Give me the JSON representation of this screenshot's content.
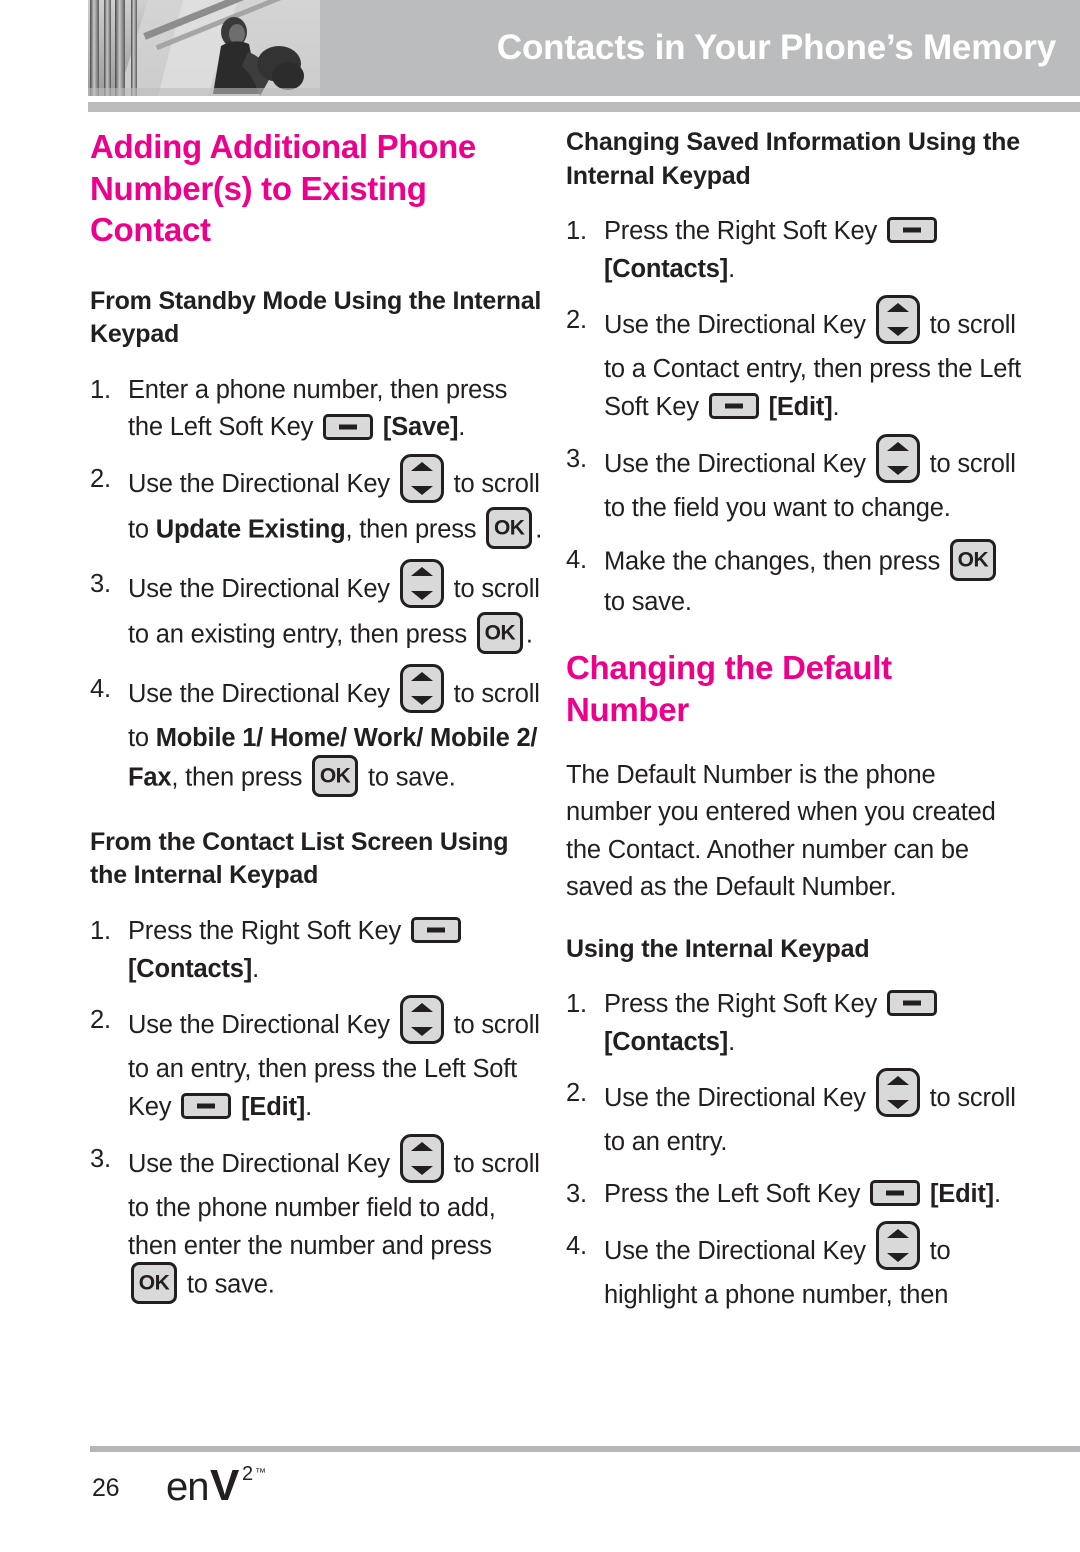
{
  "header": {
    "title": "Contacts in Your Phone’s Memory",
    "photo_alt": "person-by-railings-photo"
  },
  "colors": {
    "accent_pink": "#ec008c",
    "header_gray": "#bbbcbe",
    "text_black": "#231f20",
    "key_fill": "#d9d9da"
  },
  "left_column": {
    "section_title": "Adding Additional Phone Number(s) to Existing Contact",
    "sub1": {
      "heading": "From Standby Mode Using the Internal Keypad",
      "steps": [
        {
          "num": "1.",
          "parts": [
            {
              "t": "text",
              "v": "Enter a phone number, then press the Left Soft Key "
            },
            {
              "t": "icon",
              "v": "soft-key"
            },
            {
              "t": "text",
              "v": " "
            },
            {
              "t": "bold",
              "v": "[Save]"
            },
            {
              "t": "text",
              "v": "."
            }
          ]
        },
        {
          "num": "2.",
          "parts": [
            {
              "t": "text",
              "v": "Use the Directional Key "
            },
            {
              "t": "icon",
              "v": "directional-key"
            },
            {
              "t": "text",
              "v": " to scroll to "
            },
            {
              "t": "bold",
              "v": "Update Existing"
            },
            {
              "t": "text",
              "v": ", then press "
            },
            {
              "t": "icon",
              "v": "ok-key"
            },
            {
              "t": "text",
              "v": "."
            }
          ]
        },
        {
          "num": "3.",
          "parts": [
            {
              "t": "text",
              "v": "Use the Directional Key "
            },
            {
              "t": "icon",
              "v": "directional-key"
            },
            {
              "t": "text",
              "v": " to scroll to an existing entry, then press "
            },
            {
              "t": "icon",
              "v": "ok-key"
            },
            {
              "t": "text",
              "v": "."
            }
          ]
        },
        {
          "num": "4.",
          "parts": [
            {
              "t": "text",
              "v": "Use the Directional Key "
            },
            {
              "t": "icon",
              "v": "directional-key"
            },
            {
              "t": "text",
              "v": " to scroll to "
            },
            {
              "t": "bold",
              "v": "Mobile 1/ Home/ Work/ Mobile 2/ Fax"
            },
            {
              "t": "text",
              "v": ", then press "
            },
            {
              "t": "icon",
              "v": "ok-key"
            },
            {
              "t": "text",
              "v": " to save."
            }
          ]
        }
      ]
    },
    "sub2": {
      "heading": "From the Contact List Screen Using the Internal Keypad",
      "steps": [
        {
          "num": "1.",
          "parts": [
            {
              "t": "text",
              "v": "Press the Right Soft Key "
            },
            {
              "t": "icon",
              "v": "soft-key"
            },
            {
              "t": "text",
              "v": " "
            },
            {
              "t": "bold",
              "v": "[Contacts]"
            },
            {
              "t": "text",
              "v": "."
            }
          ]
        },
        {
          "num": "2.",
          "parts": [
            {
              "t": "text",
              "v": "Use the Directional Key "
            },
            {
              "t": "icon",
              "v": "directional-key"
            },
            {
              "t": "text",
              "v": " to scroll to an entry, then press the Left Soft Key "
            },
            {
              "t": "icon",
              "v": "soft-key"
            },
            {
              "t": "text",
              "v": " "
            },
            {
              "t": "bold",
              "v": "[Edit]"
            },
            {
              "t": "text",
              "v": "."
            }
          ]
        },
        {
          "num": "3.",
          "parts": [
            {
              "t": "text",
              "v": "Use the Directional Key "
            },
            {
              "t": "icon",
              "v": "directional-key"
            },
            {
              "t": "text",
              "v": " to scroll to the phone number field to add, then enter the number and press "
            },
            {
              "t": "icon",
              "v": "ok-key"
            },
            {
              "t": "text",
              "v": " to save."
            }
          ]
        }
      ]
    }
  },
  "right_column": {
    "sub1": {
      "heading": "Changing Saved Information Using the Internal Keypad",
      "steps": [
        {
          "num": "1.",
          "parts": [
            {
              "t": "text",
              "v": "Press the Right Soft Key "
            },
            {
              "t": "icon",
              "v": "soft-key"
            },
            {
              "t": "text",
              "v": " "
            },
            {
              "t": "bold",
              "v": "[Contacts]"
            },
            {
              "t": "text",
              "v": "."
            }
          ]
        },
        {
          "num": "2.",
          "parts": [
            {
              "t": "text",
              "v": "Use the Directional Key "
            },
            {
              "t": "icon",
              "v": "directional-key"
            },
            {
              "t": "text",
              "v": " to scroll to a Contact entry, then press the Left Soft Key "
            },
            {
              "t": "icon",
              "v": "soft-key"
            },
            {
              "t": "text",
              "v": " "
            },
            {
              "t": "bold",
              "v": "[Edit]"
            },
            {
              "t": "text",
              "v": "."
            }
          ]
        },
        {
          "num": "3.",
          "parts": [
            {
              "t": "text",
              "v": "Use the Directional Key "
            },
            {
              "t": "icon",
              "v": "directional-key"
            },
            {
              "t": "text",
              "v": " to scroll to the field you want to change."
            }
          ]
        },
        {
          "num": "4.",
          "parts": [
            {
              "t": "text",
              "v": "Make the changes, then press "
            },
            {
              "t": "icon",
              "v": "ok-key"
            },
            {
              "t": "text",
              "v": " to save."
            }
          ]
        }
      ]
    },
    "section_title": "Changing the Default Number",
    "intro": "The Default Number is the phone number you entered when you created the Contact. Another number can be saved as the Default Number.",
    "sub2": {
      "heading": "Using the Internal Keypad",
      "steps": [
        {
          "num": "1.",
          "parts": [
            {
              "t": "text",
              "v": "Press the Right Soft Key "
            },
            {
              "t": "icon",
              "v": "soft-key"
            },
            {
              "t": "text",
              "v": " "
            },
            {
              "t": "bold",
              "v": "[Contacts]"
            },
            {
              "t": "text",
              "v": "."
            }
          ]
        },
        {
          "num": "2.",
          "parts": [
            {
              "t": "text",
              "v": "Use the Directional Key "
            },
            {
              "t": "icon",
              "v": "directional-key"
            },
            {
              "t": "text",
              "v": " to scroll to an entry."
            }
          ]
        },
        {
          "num": "3.",
          "parts": [
            {
              "t": "text",
              "v": "Press the Left Soft Key "
            },
            {
              "t": "icon",
              "v": "soft-key"
            },
            {
              "t": "text",
              "v": " "
            },
            {
              "t": "bold",
              "v": "[Edit]"
            },
            {
              "t": "text",
              "v": "."
            }
          ]
        },
        {
          "num": "4.",
          "parts": [
            {
              "t": "text",
              "v": "Use the Directional Key "
            },
            {
              "t": "icon",
              "v": "directional-key"
            },
            {
              "t": "text",
              "v": " to highlight a phone number, then"
            }
          ]
        }
      ]
    }
  },
  "footer": {
    "page_number": "26",
    "logo_text": "enV",
    "logo_superscript": "2",
    "logo_trademark": "™"
  },
  "icon_labels": {
    "soft_key": "soft-key-icon",
    "directional_key": "directional-key-icon",
    "ok_key": "ok-key-icon"
  }
}
